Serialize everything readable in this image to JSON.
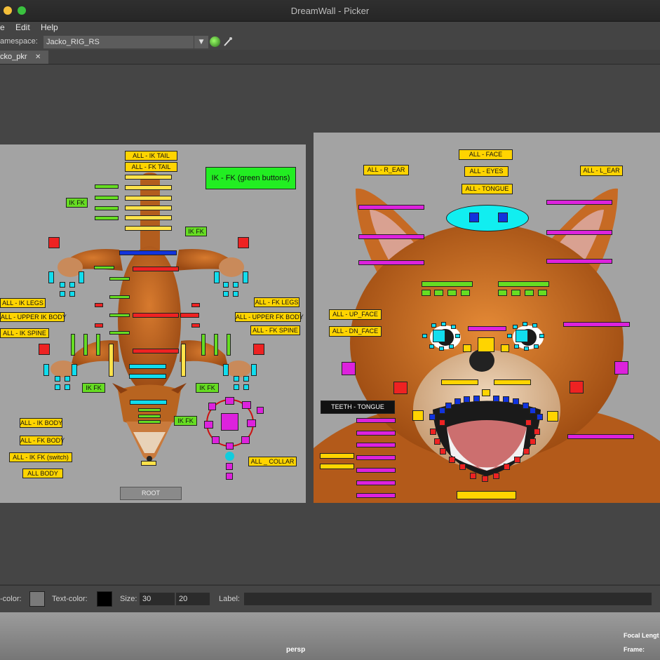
{
  "window": {
    "title": "DreamWall - Picker"
  },
  "menu": {
    "file": "e",
    "edit": "Edit",
    "help": "Help"
  },
  "namespace": {
    "label": "amespace:",
    "value": "Jacko_RIG_RS"
  },
  "tab": {
    "label": "cko_pkr",
    "close": "✕"
  },
  "body_panel": {
    "ik_tail": "ALL - IK TAIL",
    "fk_tail": "ALL - FK TAIL",
    "ikfk_green": "IK - FK (green buttons)",
    "ik_fk": "IK FK",
    "ik_legs": "ALL - IK LEGS",
    "upper_ik_body": "ALL - UPPER IK BODY",
    "ik_spine": "ALL - IK SPINE",
    "fk_legs": "ALL - FK LEGS",
    "upper_fk_body": "ALL - UPPER FK BODY",
    "fk_spine": "ALL - FK SPINE",
    "ik_body": "ALL - IK BODY",
    "fk_body": "ALL - FK BODY",
    "ikfk_switch": "ALL - IK FK (switch)",
    "all_body": "ALL BODY",
    "collar": "ALL _ COLLAR",
    "root": "ROOT"
  },
  "face_panel": {
    "face": "ALL - FACE",
    "eyes": "ALL - EYES",
    "tongue": "ALL - TONGUE",
    "r_ear": "ALL - R_EAR",
    "l_ear": "ALL - L_EAR",
    "up_face": "ALL - UP_FACE",
    "dn_face": "ALL - DN_FACE",
    "teeth_tongue": "TEETH - TONGUE"
  },
  "bottom": {
    "bg_label": "-color:",
    "text_label": "Text-color:",
    "size_label": "Size:",
    "size_w": "30",
    "size_h": "20",
    "label_label": "Label:",
    "bg_color": "#7a7a7a",
    "text_color": "#000000"
  },
  "viewport": {
    "camera": "persp",
    "focal": "Focal Lengt",
    "frame": "Frame:"
  },
  "colors": {
    "yellow": "#ffd400",
    "green": "#66dd22",
    "red": "#ee2222",
    "blue": "#1133dd",
    "cyan": "#11ddee",
    "magenta": "#dd22dd"
  }
}
